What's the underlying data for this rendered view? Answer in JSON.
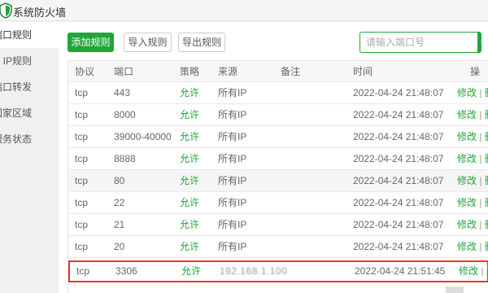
{
  "window": {
    "title": "系统防火墙"
  },
  "sidebar": {
    "items": [
      {
        "label": "端口规则",
        "active": true
      },
      {
        "label": "IP规则",
        "active": false
      },
      {
        "label": "端口转发",
        "active": false
      },
      {
        "label": "国家区域",
        "active": false
      },
      {
        "label": "服务状态",
        "active": false
      }
    ]
  },
  "toolbar": {
    "add_label": "添加规则",
    "import_label": "导入规则",
    "export_label": "导出规则",
    "search_placeholder": "请输入端口号"
  },
  "table": {
    "headers": {
      "proto": "协议",
      "port": "端口",
      "policy": "策略",
      "source": "来源",
      "note": "备注",
      "time": "时间",
      "ops": "操"
    },
    "rows": [
      {
        "proto": "tcp",
        "port": "443",
        "policy": "允许",
        "source": "所有IP",
        "note": "",
        "time": "2022-04-24 21:48:07"
      },
      {
        "proto": "tcp",
        "port": "8000",
        "policy": "允许",
        "source": "所有IP",
        "note": "",
        "time": "2022-04-24 21:48:07"
      },
      {
        "proto": "tcp",
        "port": "39000-40000",
        "policy": "允许",
        "source": "所有IP",
        "note": "",
        "time": "2022-04-24 21:48:07"
      },
      {
        "proto": "tcp",
        "port": "8888",
        "policy": "允许",
        "source": "所有IP",
        "note": "",
        "time": "2022-04-24 21:48:07"
      },
      {
        "proto": "tcp",
        "port": "80",
        "policy": "允许",
        "source": "所有IP",
        "note": "",
        "time": "2022-04-24 21:48:07"
      },
      {
        "proto": "tcp",
        "port": "22",
        "policy": "允许",
        "source": "所有IP",
        "note": "",
        "time": "2022-04-24 21:48:07"
      },
      {
        "proto": "tcp",
        "port": "21",
        "policy": "允许",
        "source": "所有IP",
        "note": "",
        "time": "2022-04-24 21:48:07"
      },
      {
        "proto": "tcp",
        "port": "20",
        "policy": "允许",
        "source": "所有IP",
        "note": "",
        "time": "2022-04-24 21:48:07"
      },
      {
        "proto": "tcp",
        "port": "3306",
        "policy": "允许",
        "source": "192.168.1.100",
        "note": "",
        "time": "2022-04-24 21:51:45"
      }
    ],
    "edit_label": "修改",
    "separator": "|",
    "delete_label": "删"
  },
  "colors": {
    "accent": "#20a53a",
    "highlight_border": "#e33"
  }
}
